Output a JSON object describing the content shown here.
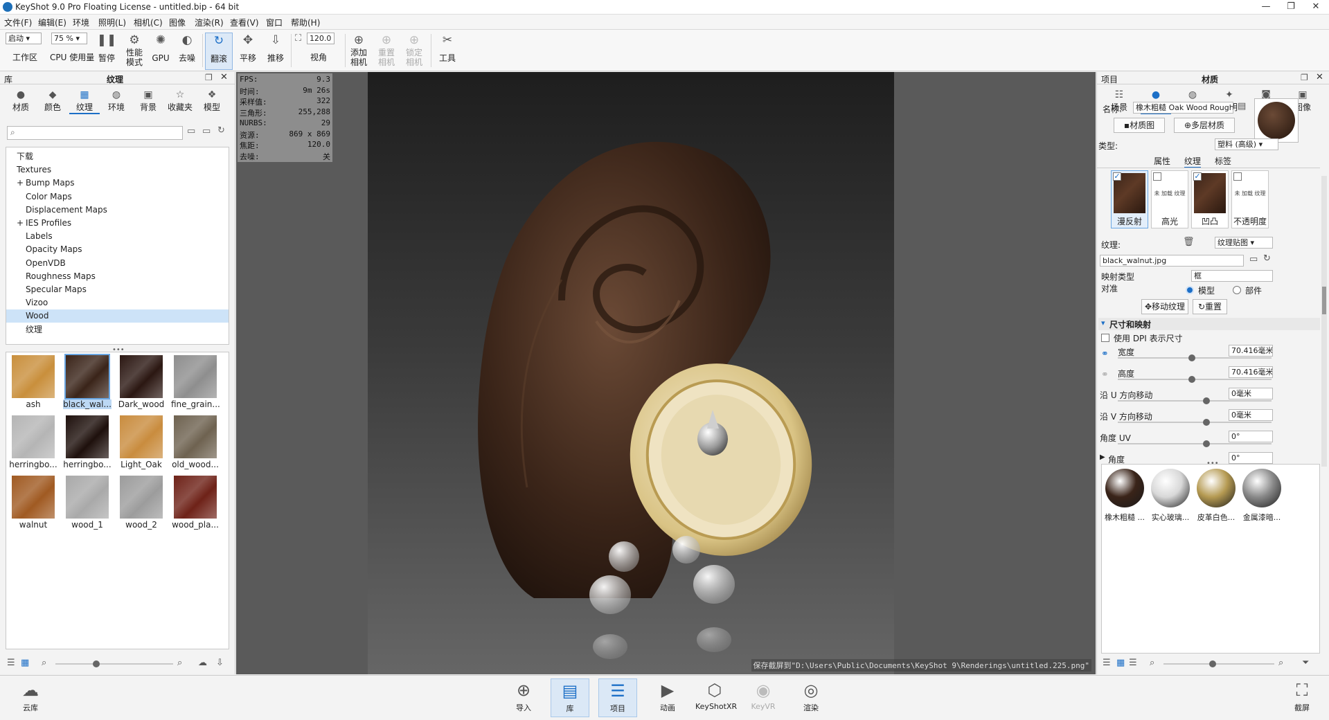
{
  "window": {
    "title": "KeyShot 9.0 Pro Floating License - untitled.bip - 64 bit",
    "controls": [
      "—",
      "❐",
      "✕"
    ]
  },
  "menubar": {
    "items": [
      "文件(F)",
      "编辑(E)",
      "环境",
      "照明(L)",
      "相机(C)",
      "图像",
      "渲染(R)",
      "查看(V)",
      "窗口",
      "帮助(H)"
    ]
  },
  "toolbar": {
    "workspace_select": "启动",
    "workspace_label": "工作区",
    "cpu_select": "75 %",
    "cpu_label": "CPU 使用量",
    "pause_label": "暂停",
    "perf_label_1": "性能",
    "perf_label_2": "模式",
    "gpu_label": "GPU",
    "denoise_label": "去噪",
    "tumble_label": "翻滚",
    "pan_label": "平移",
    "dolly_label": "推移",
    "fov_value": "120.0",
    "fov_label": "视角",
    "add_cam_1": "添加",
    "add_cam_2": "相机",
    "reset_cam_1": "重置",
    "reset_cam_2": "相机",
    "lock_cam_1": "锁定",
    "lock_cam_2": "相机",
    "tools_label": "工具"
  },
  "library": {
    "panel_left": "库",
    "panel_title": "纹理",
    "tabs": [
      "材质",
      "颜色",
      "纹理",
      "环境",
      "背景",
      "收藏夹",
      "模型"
    ],
    "search_placeholder": "",
    "tree": [
      {
        "label": "下载",
        "indent": 1,
        "expander": ""
      },
      {
        "label": "Textures",
        "indent": 1,
        "expander": ""
      },
      {
        "label": "Bump Maps",
        "indent": 2,
        "expander": "+"
      },
      {
        "label": "Color Maps",
        "indent": 2,
        "expander": ""
      },
      {
        "label": "Displacement Maps",
        "indent": 2,
        "expander": ""
      },
      {
        "label": "IES Profiles",
        "indent": 2,
        "expander": "+"
      },
      {
        "label": "Labels",
        "indent": 2,
        "expander": ""
      },
      {
        "label": "Opacity Maps",
        "indent": 2,
        "expander": ""
      },
      {
        "label": "OpenVDB",
        "indent": 2,
        "expander": ""
      },
      {
        "label": "Roughness Maps",
        "indent": 2,
        "expander": ""
      },
      {
        "label": "Specular Maps",
        "indent": 2,
        "expander": ""
      },
      {
        "label": "Vizoo",
        "indent": 2,
        "expander": ""
      },
      {
        "label": "Wood",
        "indent": 2,
        "expander": "",
        "selected": true
      },
      {
        "label": "纹理",
        "indent": 2,
        "expander": ""
      }
    ],
    "thumbnails": [
      {
        "label": "ash",
        "color": "#c98f3c"
      },
      {
        "label": "black_wal...",
        "color": "#3a2419",
        "selected": true
      },
      {
        "label": "Dark_wood",
        "color": "#2b1712"
      },
      {
        "label": "fine_grain...",
        "color": "#8e8e8e"
      },
      {
        "label": "herringbo...",
        "color": "#b5b5b5"
      },
      {
        "label": "herringbo...",
        "color": "#1e100c"
      },
      {
        "label": "Light_Oak",
        "color": "#c98c3e"
      },
      {
        "label": "old_wood...",
        "color": "#6e6250"
      },
      {
        "label": "walnut",
        "color": "#a05a22"
      },
      {
        "label": "wood_1",
        "color": "#a9a9a9"
      },
      {
        "label": "wood_2",
        "color": "#9c9c9c"
      },
      {
        "label": "wood_pla...",
        "color": "#6e2218"
      }
    ]
  },
  "viewport": {
    "stats": [
      {
        "k": "FPS:",
        "v": "9.3"
      },
      {
        "k": "时间:",
        "v": "9m 26s"
      },
      {
        "k": "采样值:",
        "v": "322"
      },
      {
        "k": "三角形:",
        "v": "255,288"
      },
      {
        "k": "NURBS:",
        "v": "29"
      },
      {
        "k": "资源:",
        "v": "869 x 869"
      },
      {
        "k": "焦距:",
        "v": "120.0"
      },
      {
        "k": "去噪:",
        "v": "关"
      }
    ],
    "status_message": "保存截屏到\"D:\\Users\\Public\\Documents\\KeyShot 9\\Renderings\\untitled.225.png\""
  },
  "project": {
    "panel_left": "项目",
    "panel_title": "材质",
    "tabs": [
      "场景",
      "材质",
      "环境",
      "照明",
      "相机",
      "图像"
    ],
    "name_label": "名称:",
    "name_value": "橡木粗糙 Oak Wood Rough",
    "material_graph_btn": "材质图",
    "multi_material_btn": "多层材质",
    "type_label": "类型:",
    "type_value": "塑料 (高级)",
    "subtabs": [
      "属性",
      "纹理",
      "标签"
    ],
    "texture_slots": [
      {
        "label": "漫反射",
        "checked": true,
        "filled": true
      },
      {
        "label": "高光",
        "checked": false,
        "filled": false,
        "hint": "未 加载 纹理"
      },
      {
        "label": "凹凸",
        "checked": true,
        "filled": true
      },
      {
        "label": "不透明度",
        "checked": false,
        "filled": false,
        "hint": "未 加载 纹理"
      }
    ],
    "texture_label": "纹理:",
    "texture_type": "纹理贴图",
    "texture_file": "black_walnut.jpg",
    "mapping_label": "映射类型",
    "mapping_value": "框",
    "align_label": "对准",
    "align_model": "模型",
    "align_part": "部件",
    "move_texture_btn": "移动纹理",
    "reset_btn": "重置",
    "section_title": "尺寸和映射",
    "use_dpi_label": "使用 DPI 表示尺寸",
    "width_label": "宽度",
    "width_value": "70.416毫米",
    "height_label": "高度",
    "height_value": "70.416毫米",
    "u_label": "沿 U 方向移动",
    "u_value": "0毫米",
    "v_label": "沿 V 方向移动",
    "v_value": "0毫米",
    "uv_angle_label": "角度 UV",
    "uv_angle_value": "0°",
    "angle_label": "角度",
    "angle_value": "0°",
    "materials": [
      {
        "label": "橡木粗糙 ...",
        "color": "#3a2419"
      },
      {
        "label": "实心玻璃...",
        "color": "#d8d8d8"
      },
      {
        "label": "皮革白色...",
        "color": "#b59a52"
      },
      {
        "label": "金属漆暗...",
        "color": "#8a8a8a"
      }
    ]
  },
  "bottombar": {
    "cloud_label": "云库",
    "import_label": "导入",
    "library_label": "库",
    "project_label": "项目",
    "animation_label": "动画",
    "keyshotxr_label": "KeyShotXR",
    "keyvr_label": "KeyVR",
    "render_label": "渲染",
    "screenshot_label": "截屏"
  }
}
